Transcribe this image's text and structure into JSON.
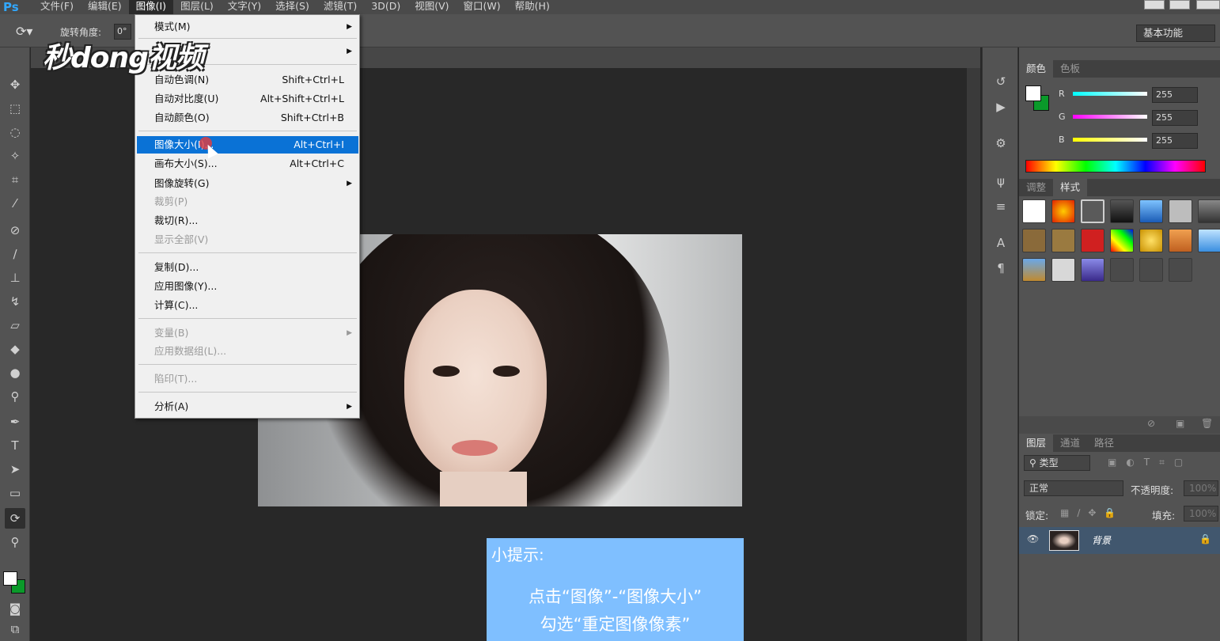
{
  "menubar": {
    "logo": "Ps",
    "items": [
      "文件(F)",
      "编辑(E)",
      "图像(I)",
      "图层(L)",
      "文字(Y)",
      "选择(S)",
      "滤镜(T)",
      "3D(D)",
      "视图(V)",
      "窗口(W)",
      "帮助(H)"
    ]
  },
  "options": {
    "rotate_label": "旋转角度:",
    "rotate_value": "0°",
    "workspace": "基本功能"
  },
  "watermark": "秒dong视频",
  "image_menu": {
    "items": [
      {
        "label": "模式(M)",
        "shortcut": "",
        "submenu": true,
        "disabled": false
      },
      {
        "label": "",
        "shortcut": "",
        "submenu": true,
        "disabled": false
      },
      {
        "label": "自动色调(N)",
        "shortcut": "Shift+Ctrl+L",
        "submenu": false,
        "disabled": false
      },
      {
        "label": "自动对比度(U)",
        "shortcut": "Alt+Shift+Ctrl+L",
        "submenu": false,
        "disabled": false
      },
      {
        "label": "自动颜色(O)",
        "shortcut": "Shift+Ctrl+B",
        "submenu": false,
        "disabled": false
      },
      {
        "label": "图像大小(I)...",
        "shortcut": "Alt+Ctrl+I",
        "submenu": false,
        "disabled": false
      },
      {
        "label": "画布大小(S)...",
        "shortcut": "Alt+Ctrl+C",
        "submenu": false,
        "disabled": false
      },
      {
        "label": "图像旋转(G)",
        "shortcut": "",
        "submenu": true,
        "disabled": false
      },
      {
        "label": "裁剪(P)",
        "shortcut": "",
        "submenu": false,
        "disabled": true
      },
      {
        "label": "裁切(R)...",
        "shortcut": "",
        "submenu": false,
        "disabled": false
      },
      {
        "label": "显示全部(V)",
        "shortcut": "",
        "submenu": false,
        "disabled": true
      },
      {
        "label": "复制(D)...",
        "shortcut": "",
        "submenu": false,
        "disabled": false
      },
      {
        "label": "应用图像(Y)...",
        "shortcut": "",
        "submenu": false,
        "disabled": false
      },
      {
        "label": "计算(C)...",
        "shortcut": "",
        "submenu": false,
        "disabled": false
      },
      {
        "label": "变量(B)",
        "shortcut": "",
        "submenu": true,
        "disabled": true
      },
      {
        "label": "应用数据组(L)...",
        "shortcut": "",
        "submenu": false,
        "disabled": true
      },
      {
        "label": "陷印(T)...",
        "shortcut": "",
        "submenu": false,
        "disabled": true
      },
      {
        "label": "分析(A)",
        "shortcut": "",
        "submenu": true,
        "disabled": false
      }
    ],
    "highlighted": "图像大小(I)..."
  },
  "tip": {
    "title": "小提示:",
    "line1": "点击“图像”-“图像大小”",
    "line2": "勾选“重定图像像素”"
  },
  "color_panel": {
    "tabs": [
      "颜色",
      "色板"
    ],
    "r_label": "R",
    "r_value": "255",
    "g_label": "G",
    "g_value": "255",
    "b_label": "B",
    "b_value": "255",
    "fg": "#ffffff",
    "bg": "#0a9a2a"
  },
  "styles_panel": {
    "tabs": [
      "调整",
      "样式"
    ]
  },
  "layers_panel": {
    "tabs": [
      "图层",
      "通道",
      "路径"
    ],
    "filter_label": "类型",
    "blend_mode": "正常",
    "opacity_label": "不透明度:",
    "opacity_value": "100%",
    "lock_label": "锁定:",
    "fill_label": "填充:",
    "fill_value": "100%",
    "layer_name": "背景"
  }
}
